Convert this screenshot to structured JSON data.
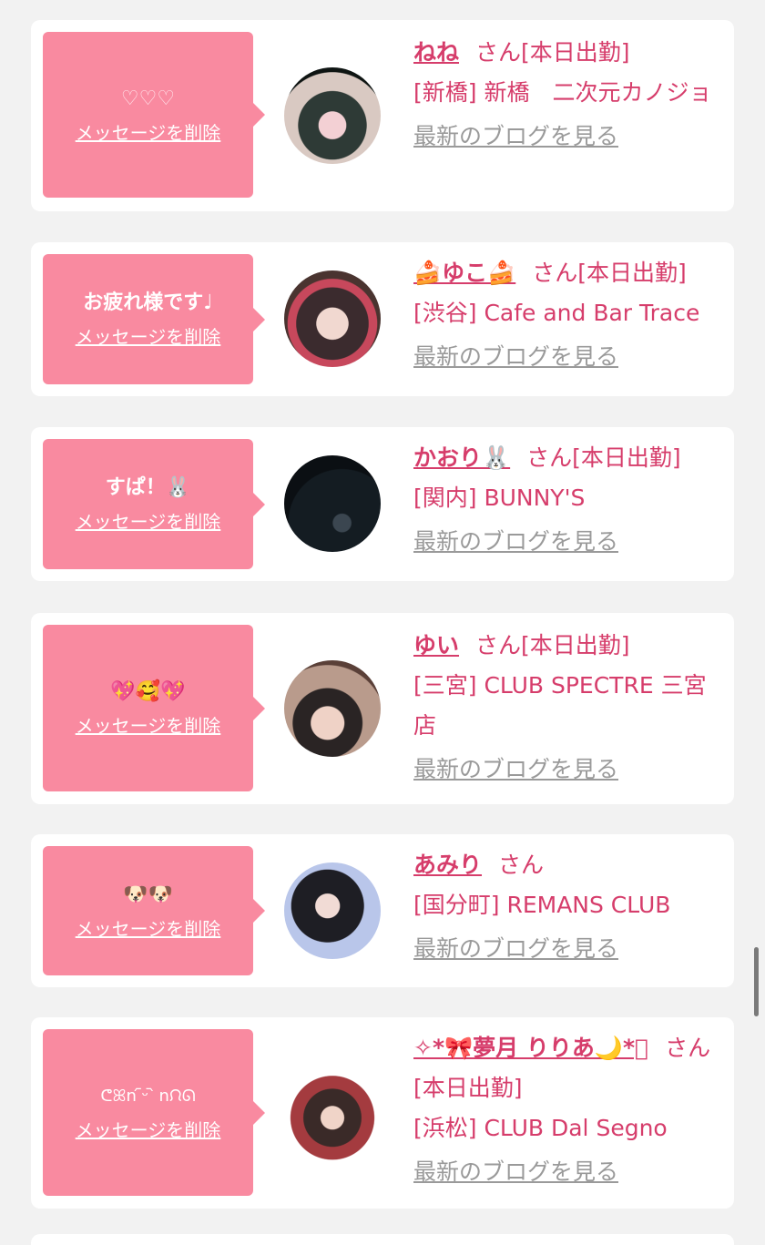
{
  "messages": [
    {
      "message": "♡♡♡",
      "delete_label": "メッセージを削除",
      "name": "ねね",
      "honorific": "さん",
      "status": "[本日出勤]",
      "shop": "[新橋] 新橋　二次元カノジョ",
      "blog_link": "最新のブログを見る"
    },
    {
      "message": "お疲れ様です♩",
      "delete_label": "メッセージを削除",
      "name": "🍰ゆこ🍰",
      "honorific": "さん",
      "status": "[本日出勤]",
      "shop": "[渋谷] Cafe and Bar Trace",
      "blog_link": "最新のブログを見る"
    },
    {
      "message": "すぱ！🐰",
      "delete_label": "メッセージを削除",
      "name": "かおり🐰",
      "honorific": "さん",
      "status": "[本日出勤]",
      "shop": "[関内] BUNNY'S",
      "blog_link": "最新のブログを見る"
    },
    {
      "message": "💖🥰💖",
      "delete_label": "メッセージを削除",
      "name": "ゆい",
      "honorific": "さん",
      "status": "[本日出勤]",
      "shop": "[三宮] CLUB SPECTRE 三宮店",
      "blog_link": "最新のブログを見る"
    },
    {
      "message": "🐶🐶",
      "delete_label": "メッセージを削除",
      "name": "あみり",
      "honorific": "さん",
      "status": "",
      "shop": "[国分町] REMANS CLUB",
      "blog_link": "最新のブログを見る"
    },
    {
      "message": "ᕦꕤn ᷇ᵕ ᷆ nᙁᘏ",
      "delete_label": "メッセージを削除",
      "name": "✧*🎀夢月 りりあ🌙*ﾟ",
      "honorific": "さん",
      "status": "[本日出勤]",
      "shop": "[浜松] CLUB Dal Segno",
      "blog_link": "最新のブログを見る"
    }
  ],
  "colors": {
    "accent_pink": "#f98aa0",
    "name_color": "#d63d6b",
    "link_gray": "#9a9a9a",
    "background": "#f2f2f2"
  }
}
